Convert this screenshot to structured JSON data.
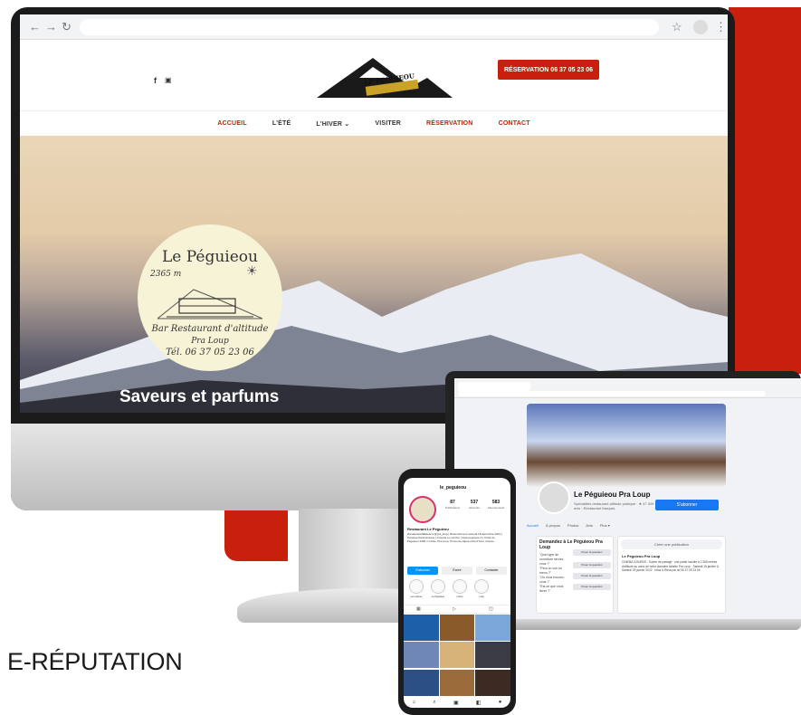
{
  "heading": "E-RÉPUTATION",
  "colors": {
    "accent": "#c8200c",
    "facebook": "#1877f2",
    "instagram": "#d6336c"
  },
  "desktop": {
    "browser": {
      "back_icon": "arrow-left-icon",
      "forward_icon": "arrow-right-icon",
      "reload_icon": "reload-icon",
      "star_icon": "star-icon",
      "menu_icon": "kebab-menu-icon"
    },
    "site": {
      "social": [
        "f",
        "▣"
      ],
      "logo_text": "LE PEGUIEOU",
      "logo_sub": "2365 m",
      "reservation_button": "RÉSERVATION 06 37 05 23 06",
      "menu": [
        "ACCUEIL",
        "L'ÉTÉ",
        "L'HIVER ⌄",
        "VISITER",
        "RÉSERVATION",
        "CONTACT"
      ],
      "badge": {
        "name": "Le Péguieou",
        "altitude": "2365 m",
        "line1": "Bar Restaurant d'altitude",
        "line2": "Pra Loup",
        "phone": "Tél. 06 37 05 23 06"
      },
      "hero_title": "Saveurs et parfums"
    }
  },
  "laptop": {
    "page_name": "Le Péguieou Pra Loup",
    "page_sub": "Spécialités restaurant altitude pratique · ★ 47 000 avis · Restaurant français",
    "follow_button": "S'abonner",
    "tabs": [
      "Accueil",
      "À propos",
      "Photos",
      "Avis",
      "Plus ▾"
    ],
    "ask_title": "Demandez à Le Péguieou Pra Loup",
    "ask_questions": [
      "\"Quel type de nourriture servez-vous ?\"",
      "\"Peut-on voir un menu ?\"",
      "\"Où vous trouvez-vous ?\"",
      "\"Est-ce que vous livrez ?\""
    ],
    "ask_button": "Poser la question",
    "compose": "Créer une publication",
    "post_title": "Le Péguieou Pra Loup",
    "post_text": "CINEMA GOURDS · Soirée de partage · une partie insolite à 2 365 mètres d'altitude au cœur de notre domaine skiable Pra Loup · Samedi 15 janvier & Samedi 29 janvier 2022 · Infos & Résa par tel 06 37 05 23 06"
  },
  "phone": {
    "username": "le_peguieou",
    "stats": [
      {
        "value": "87",
        "label": "Publications"
      },
      {
        "value": "537",
        "label": "Abonnés"
      },
      {
        "value": "583",
        "label": "Abonnements"
      }
    ],
    "bio_name": "Restaurant Le Péguieou",
    "bio": "#restaurantdaltitude à @pra_loup | Réouverture le samedi 18 décembre 2021 | Terrasse Panoramique | Ouverte en continu | www.peguieou.fr | Crête du Péguieou 2400 m Crête, Pra Loup, Provence-Alpes-Côte d'Azur, France",
    "buttons": [
      "S'abonner",
      "Écrire",
      "Contacter"
    ],
    "highlights": [
      "Les soirées",
      "Le Péguieou",
      "L'hiver",
      "L'été"
    ]
  }
}
